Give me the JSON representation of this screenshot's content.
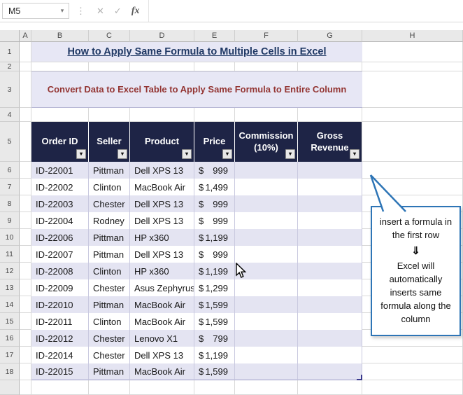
{
  "formula_bar": {
    "name_box": "M5",
    "formula_value": ""
  },
  "icons": {
    "dropdown": "▾",
    "dots": "⋮",
    "cancel": "✕",
    "check": "✓",
    "fx": "fx",
    "filter": "▾",
    "down_arrow": "⇓"
  },
  "grid": {
    "columns": [
      "A",
      "B",
      "C",
      "D",
      "E",
      "F",
      "G",
      "H"
    ],
    "rows": [
      "1",
      "2",
      "3",
      "4",
      "5",
      "6",
      "7",
      "8",
      "9",
      "10",
      "11",
      "12",
      "13",
      "14",
      "15",
      "16",
      "17",
      "18"
    ]
  },
  "title": "How to Apply Same Formula to Multiple Cells in Excel",
  "subtitle": "Convert Data to Excel Table to Apply Same Formula to Entire Column",
  "table": {
    "headers": [
      "Order ID",
      "Seller",
      "Product",
      "Price",
      "Commission (10%)",
      "Gross Revenue"
    ],
    "rows": [
      {
        "order_id": "ID-22001",
        "seller": "Pittman",
        "product": "Dell XPS 13",
        "currency": "$",
        "amount": "999",
        "commission": "",
        "gross_revenue": ""
      },
      {
        "order_id": "ID-22002",
        "seller": "Clinton",
        "product": "MacBook Air",
        "currency": "$",
        "amount": "1,499",
        "commission": "",
        "gross_revenue": ""
      },
      {
        "order_id": "ID-22003",
        "seller": "Chester",
        "product": "Dell XPS 13",
        "currency": "$",
        "amount": "999",
        "commission": "",
        "gross_revenue": ""
      },
      {
        "order_id": "ID-22004",
        "seller": "Rodney",
        "product": "Dell XPS 13",
        "currency": "$",
        "amount": "999",
        "commission": "",
        "gross_revenue": ""
      },
      {
        "order_id": "ID-22006",
        "seller": "Pittman",
        "product": "HP x360",
        "currency": "$",
        "amount": "1,199",
        "commission": "",
        "gross_revenue": ""
      },
      {
        "order_id": "ID-22007",
        "seller": "Pittman",
        "product": "Dell XPS 13",
        "currency": "$",
        "amount": "999",
        "commission": "",
        "gross_revenue": ""
      },
      {
        "order_id": "ID-22008",
        "seller": "Clinton",
        "product": "HP x360",
        "currency": "$",
        "amount": "1,199",
        "commission": "",
        "gross_revenue": ""
      },
      {
        "order_id": "ID-22009",
        "seller": "Chester",
        "product": "Asus Zephyrus",
        "currency": "$",
        "amount": "1,299",
        "commission": "",
        "gross_revenue": ""
      },
      {
        "order_id": "ID-22010",
        "seller": "Pittman",
        "product": "MacBook Air",
        "currency": "$",
        "amount": "1,599",
        "commission": "",
        "gross_revenue": ""
      },
      {
        "order_id": "ID-22011",
        "seller": "Clinton",
        "product": "MacBook Air",
        "currency": "$",
        "amount": "1,599",
        "commission": "",
        "gross_revenue": ""
      },
      {
        "order_id": "ID-22012",
        "seller": "Chester",
        "product": "Lenovo X1",
        "currency": "$",
        "amount": "799",
        "commission": "",
        "gross_revenue": ""
      },
      {
        "order_id": "ID-22014",
        "seller": "Chester",
        "product": "Dell XPS 13",
        "currency": "$",
        "amount": "1,199",
        "commission": "",
        "gross_revenue": ""
      },
      {
        "order_id": "ID-22015",
        "seller": "Pittman",
        "product": "MacBook Air",
        "currency": "$",
        "amount": "1,599",
        "commission": "",
        "gross_revenue": ""
      }
    ]
  },
  "callout": {
    "line1": "insert a formula in the first row",
    "arrow": "⇓",
    "line2": "Excel will automatically inserts same formula along the column"
  },
  "colors": {
    "table_header_bg": "#1E2446",
    "band": "#E4E4F2",
    "accent_blue": "#2E75B6",
    "title_color": "#1F3864",
    "subtitle_color": "#943634"
  }
}
